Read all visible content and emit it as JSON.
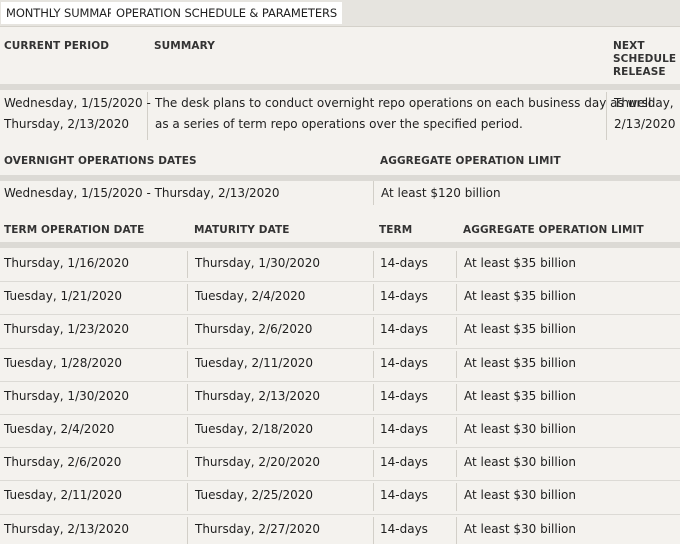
{
  "tabs": [
    {
      "label": "MONTHLY SUMMARY",
      "active": true
    },
    {
      "label": "OPERATION SCHEDULE & PARAMETERS",
      "active": false
    }
  ],
  "summary_headers": {
    "current_period": "CURRENT PERIOD",
    "summary": "SUMMARY",
    "next_release_line1": "NEXT",
    "next_release_line2": "SCHEDULE",
    "next_release_line3": "RELEASE"
  },
  "summary_row": {
    "period_line1": "Wednesday, 1/15/2020 -",
    "period_line2": "Thursday, 2/13/2020",
    "summary_line1": "The desk plans to conduct overnight repo operations on each business day as well",
    "summary_line2": "as a series of term repo operations over the specified period.",
    "release_line1": "Thursday,",
    "release_line2": "2/13/2020"
  },
  "overnight_headers": {
    "dates": "OVERNIGHT OPERATIONS DATES",
    "limit": "AGGREGATE OPERATION LIMIT"
  },
  "overnight_row": {
    "dates": "Wednesday, 1/15/2020 - Thursday, 2/13/2020",
    "limit": "At least $120 billion"
  },
  "term_headers": {
    "date": "TERM OPERATION DATE",
    "maturity": "MATURITY DATE",
    "term": "TERM",
    "limit": "AGGREGATE OPERATION LIMIT"
  },
  "term_rows": [
    {
      "date": "Thursday, 1/16/2020",
      "maturity": "Thursday, 1/30/2020",
      "term": "14-days",
      "limit": "At least $35 billion"
    },
    {
      "date": "Tuesday, 1/21/2020",
      "maturity": "Tuesday, 2/4/2020",
      "term": "14-days",
      "limit": "At least $35 billion"
    },
    {
      "date": "Thursday, 1/23/2020",
      "maturity": "Thursday, 2/6/2020",
      "term": "14-days",
      "limit": "At least $35 billion"
    },
    {
      "date": "Tuesday, 1/28/2020",
      "maturity": "Tuesday, 2/11/2020",
      "term": "14-days",
      "limit": "At least $35 billion"
    },
    {
      "date": "Thursday, 1/30/2020",
      "maturity": "Thursday, 2/13/2020",
      "term": "14-days",
      "limit": "At least $35 billion"
    },
    {
      "date": "Tuesday, 2/4/2020",
      "maturity": "Tuesday, 2/18/2020",
      "term": "14-days",
      "limit": "At least $30 billion"
    },
    {
      "date": "Thursday, 2/6/2020",
      "maturity": "Thursday, 2/20/2020",
      "term": "14-days",
      "limit": "At least $30 billion"
    },
    {
      "date": "Tuesday, 2/11/2020",
      "maturity": "Tuesday, 2/25/2020",
      "term": "14-days",
      "limit": "At least $30 billion"
    },
    {
      "date": "Thursday, 2/13/2020",
      "maturity": "Thursday, 2/27/2020",
      "term": "14-days",
      "limit": "At least $30 billion"
    }
  ]
}
